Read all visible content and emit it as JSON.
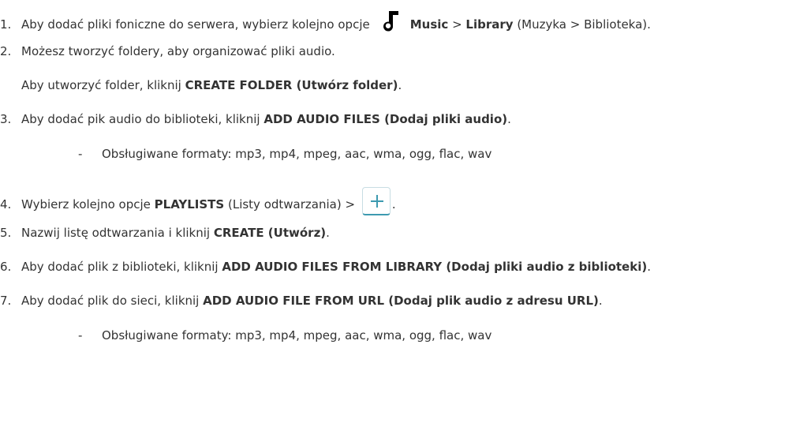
{
  "steps": [
    {
      "num": "1.",
      "pre": "Aby dodać pliki foniczne do serwera, wybierz kolejno opcje",
      "icon": "music-note-icon",
      "bold1": "Music",
      "sep1": " > ",
      "bold2": "Library",
      "post": " (Muzyka > Biblioteka)."
    },
    {
      "num": "2.",
      "text": "Możesz tworzyć foldery, aby organizować pliki audio."
    },
    {
      "pre": "Aby utworzyć folder, kliknij ",
      "bold": "CREATE FOLDER (Utwórz folder)",
      "post": "."
    },
    {
      "num": "3.",
      "pre": "Aby dodać pik audio do biblioteki, kliknij ",
      "bold": "ADD AUDIO FILES (Dodaj pliki audio)",
      "post": "."
    },
    {
      "dash": "-",
      "text": "Obsługiwane formaty: mp3, mp4, mpeg, aac, wma, ogg, flac, wav"
    },
    {
      "num": "4.",
      "pre": "Wybierz kolejno opcje ",
      "bold": "PLAYLISTS",
      "mid": " (Listy odtwarzania) > ",
      "icon": "plus-icon",
      "post": "."
    },
    {
      "num": "5.",
      "pre": "Nazwij listę odtwarzania i kliknij ",
      "bold": "CREATE (Utwórz)",
      "post": "."
    },
    {
      "num": "6.",
      "pre": "Aby dodać plik z biblioteki, kliknij ",
      "bold": "ADD AUDIO FILES FROM LIBRARY (Dodaj pliki audio z biblioteki)",
      "post": "."
    },
    {
      "num": "7.",
      "pre": "Aby dodać plik do sieci, kliknij ",
      "bold": "ADD AUDIO FILE FROM URL (Dodaj plik audio z adresu URL)",
      "post": "."
    },
    {
      "dash": "-",
      "text": "Obsługiwane formaty: mp3, mp4, mpeg, aac, wma, ogg, flac, wav"
    }
  ],
  "colors": {
    "text": "#333333",
    "accent": "#3d9ab0"
  }
}
